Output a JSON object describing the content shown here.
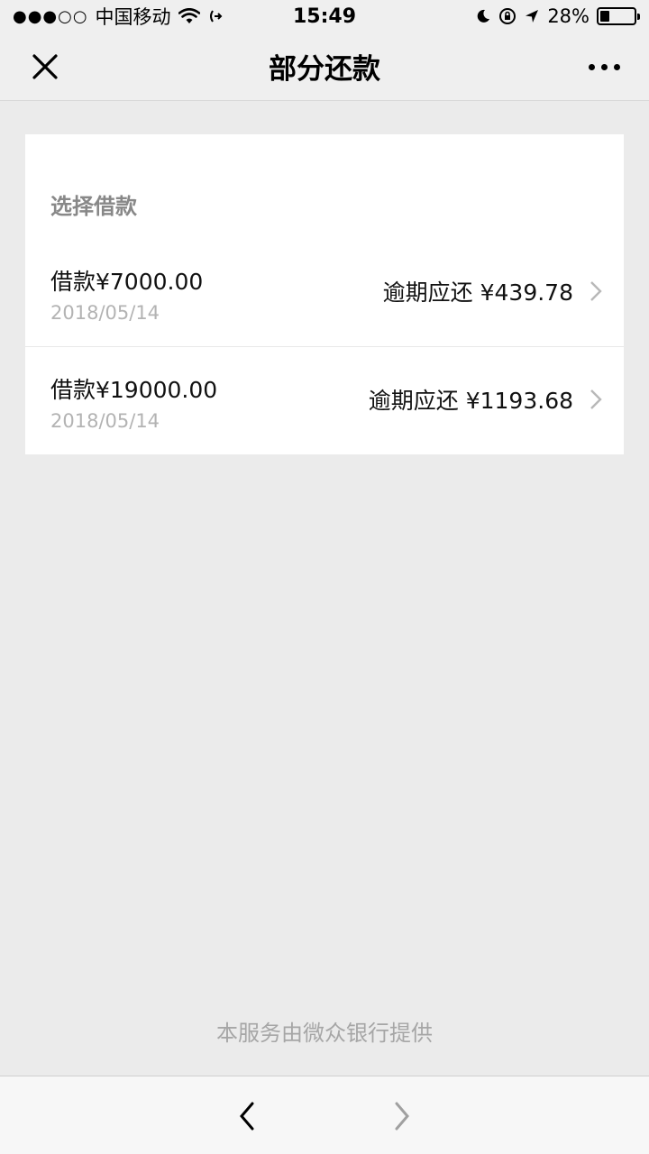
{
  "status_bar": {
    "signal": "●●●○○",
    "carrier": "中国移动",
    "time": "15:49",
    "battery": "28%",
    "battery_level": 0.28
  },
  "nav": {
    "title": "部分还款"
  },
  "section": {
    "title": "选择借款"
  },
  "loans": [
    {
      "amount": "借款¥7000.00",
      "date": "2018/05/14",
      "overdue": "逾期应还 ¥439.78"
    },
    {
      "amount": "借款¥19000.00",
      "date": "2018/05/14",
      "overdue": "逾期应还 ¥1193.68"
    }
  ],
  "footer": {
    "provider": "本服务由微众银行提供"
  },
  "colors": {
    "background": "#ebebeb",
    "bar": "#efefef",
    "muted_text": "#888888"
  }
}
